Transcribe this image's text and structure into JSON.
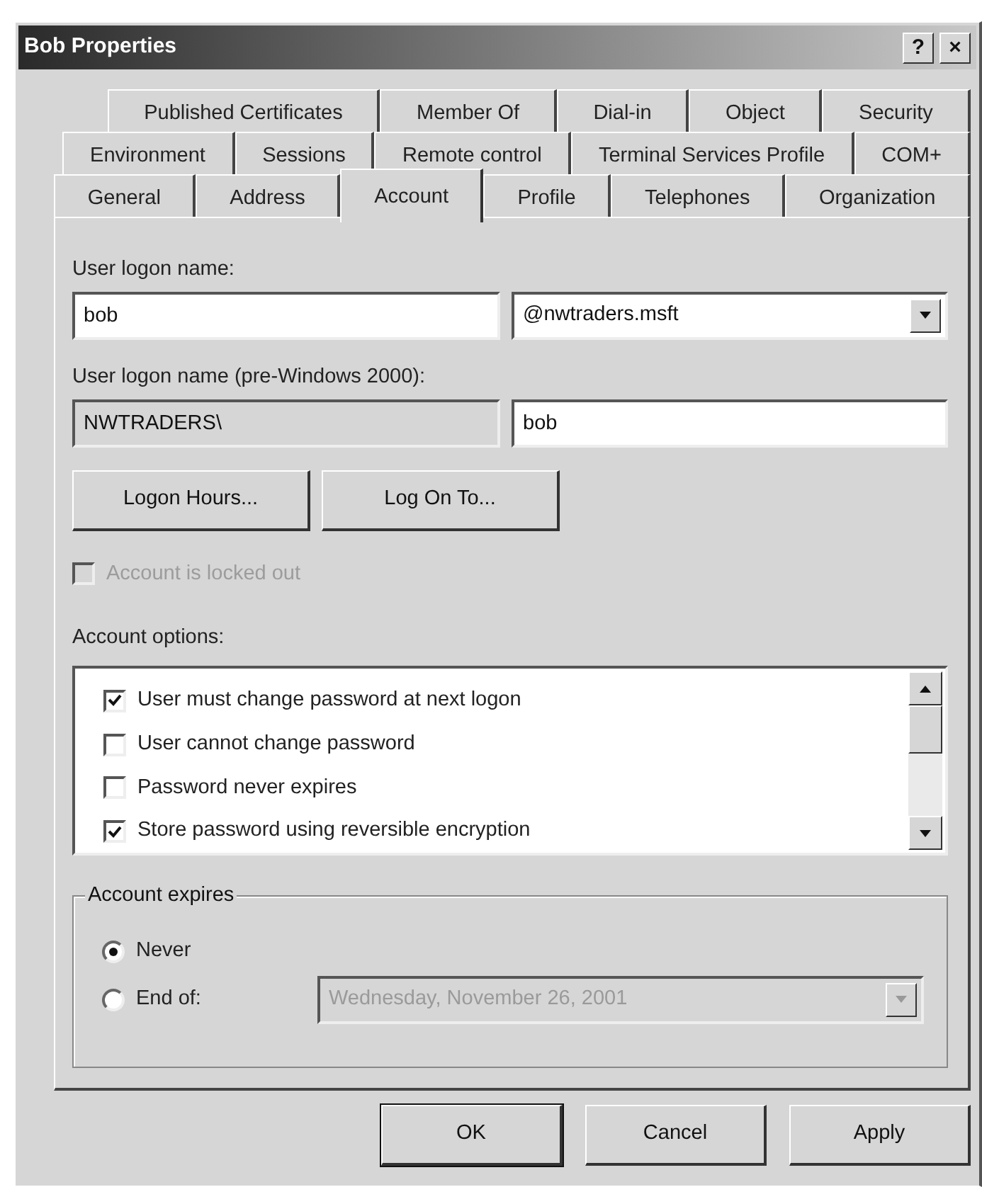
{
  "window": {
    "title": "Bob Properties",
    "controls": [
      "?",
      "×"
    ]
  },
  "tab_rows": [
    [
      {
        "label": "Published Certificates",
        "selected": false
      },
      {
        "label": "Member Of",
        "selected": false
      },
      {
        "label": "Dial-in",
        "selected": false
      },
      {
        "label": "Object",
        "selected": false
      },
      {
        "label": "Security",
        "selected": false
      }
    ],
    [
      {
        "label": "Environment",
        "selected": false
      },
      {
        "label": "Sessions",
        "selected": false
      },
      {
        "label": "Remote control",
        "selected": false
      },
      {
        "label": "Terminal Services Profile",
        "selected": false
      },
      {
        "label": "COM+",
        "selected": false
      }
    ],
    [
      {
        "label": "General",
        "selected": false
      },
      {
        "label": "Address",
        "selected": false
      },
      {
        "label": "Account",
        "selected": true
      },
      {
        "label": "Profile",
        "selected": false
      },
      {
        "label": "Telephones",
        "selected": false
      },
      {
        "label": "Organization",
        "selected": false
      }
    ]
  ],
  "user_logon_name": {
    "label": "User logon name:",
    "value": "bob",
    "domain": "@nwtraders.msft"
  },
  "pre_windows_2000": {
    "label": "User logon name (pre-Windows 2000):",
    "domain": "NWTRADERS\\",
    "value": "bob"
  },
  "action_buttons": [
    "Logon Hours...",
    "Log On To..."
  ],
  "locked_out": {
    "label": "Account is locked out",
    "checked": false,
    "disabled": true
  },
  "account_options": {
    "label": "Account options:",
    "items": [
      {
        "label": "User must change password at next logon",
        "checked": true
      },
      {
        "label": "User cannot change password",
        "checked": false
      },
      {
        "label": "Password never expires",
        "checked": false
      },
      {
        "label": "Store password using reversible encryption",
        "checked": true
      }
    ]
  },
  "account_expires": {
    "label": "Account expires",
    "options": [
      {
        "label": "Never",
        "selected": true
      },
      {
        "label": "End of:",
        "selected": false
      }
    ],
    "date": "Wednesday, November 26, 2001",
    "date_disabled": true
  },
  "buttons": [
    {
      "label": "OK",
      "default": true
    },
    {
      "label": "Cancel",
      "default": false
    },
    {
      "label": "Apply",
      "default": false
    }
  ]
}
